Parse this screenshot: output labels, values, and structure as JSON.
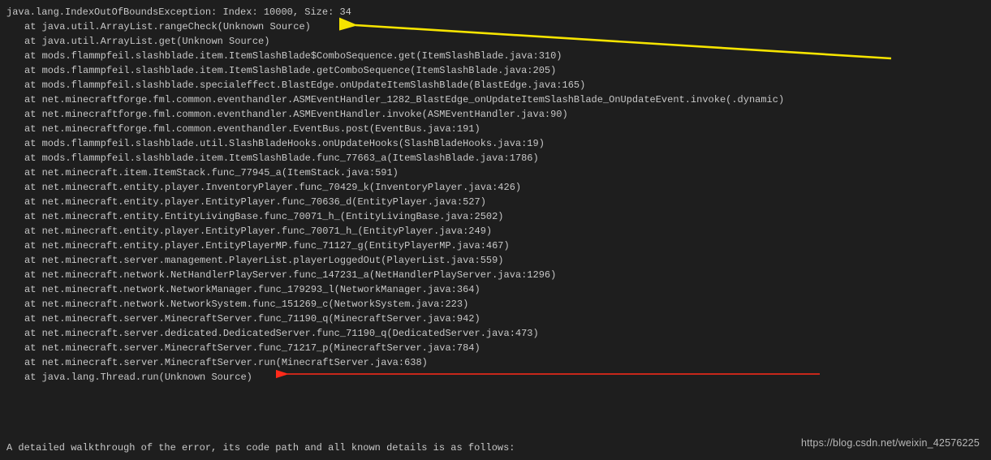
{
  "header": "java.lang.IndexOutOfBoundsException: Index: 10000, Size: 34",
  "stack": [
    "at java.util.ArrayList.rangeCheck(Unknown Source)",
    "at java.util.ArrayList.get(Unknown Source)",
    "at mods.flammpfeil.slashblade.item.ItemSlashBlade$ComboSequence.get(ItemSlashBlade.java:310)",
    "at mods.flammpfeil.slashblade.item.ItemSlashBlade.getComboSequence(ItemSlashBlade.java:205)",
    "at mods.flammpfeil.slashblade.specialeffect.BlastEdge.onUpdateItemSlashBlade(BlastEdge.java:165)",
    "at net.minecraftforge.fml.common.eventhandler.ASMEventHandler_1282_BlastEdge_onUpdateItemSlashBlade_OnUpdateEvent.invoke(.dynamic)",
    "at net.minecraftforge.fml.common.eventhandler.ASMEventHandler.invoke(ASMEventHandler.java:90)",
    "at net.minecraftforge.fml.common.eventhandler.EventBus.post(EventBus.java:191)",
    "at mods.flammpfeil.slashblade.util.SlashBladeHooks.onUpdateHooks(SlashBladeHooks.java:19)",
    "at mods.flammpfeil.slashblade.item.ItemSlashBlade.func_77663_a(ItemSlashBlade.java:1786)",
    "at net.minecraft.item.ItemStack.func_77945_a(ItemStack.java:591)",
    "at net.minecraft.entity.player.InventoryPlayer.func_70429_k(InventoryPlayer.java:426)",
    "at net.minecraft.entity.player.EntityPlayer.func_70636_d(EntityPlayer.java:527)",
    "at net.minecraft.entity.EntityLivingBase.func_70071_h_(EntityLivingBase.java:2502)",
    "at net.minecraft.entity.player.EntityPlayer.func_70071_h_(EntityPlayer.java:249)",
    "at net.minecraft.entity.player.EntityPlayerMP.func_71127_g(EntityPlayerMP.java:467)",
    "at net.minecraft.server.management.PlayerList.playerLoggedOut(PlayerList.java:559)",
    "at net.minecraft.network.NetHandlerPlayServer.func_147231_a(NetHandlerPlayServer.java:1296)",
    "at net.minecraft.network.NetworkManager.func_179293_l(NetworkManager.java:364)",
    "at net.minecraft.network.NetworkSystem.func_151269_c(NetworkSystem.java:223)",
    "at net.minecraft.server.MinecraftServer.func_71190_q(MinecraftServer.java:942)",
    "at net.minecraft.server.dedicated.DedicatedServer.func_71190_q(DedicatedServer.java:473)",
    "at net.minecraft.server.MinecraftServer.func_71217_p(MinecraftServer.java:784)",
    "at net.minecraft.server.MinecraftServer.run(MinecraftServer.java:638)",
    "at java.lang.Thread.run(Unknown Source)"
  ],
  "footer": "A detailed walkthrough of the error, its code path and all known details is as follows:",
  "watermark": "https://blog.csdn.net/weixin_42576225",
  "arrows": {
    "yellow": {
      "color": "#f6e400"
    },
    "red": {
      "color": "#ff2a1a"
    }
  }
}
